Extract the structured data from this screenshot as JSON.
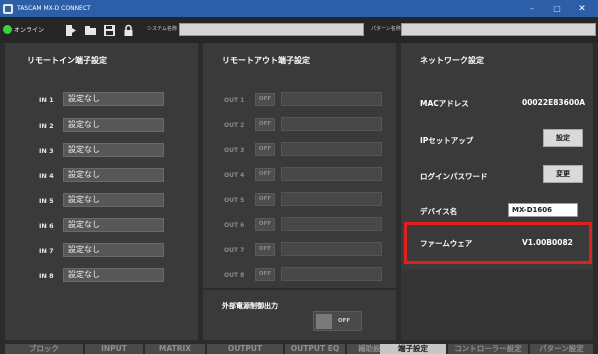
{
  "window": {
    "title": "TASCAM MX-D CONNECT",
    "minimize": "–",
    "maximize": "□",
    "close": "✕"
  },
  "toolbar": {
    "status": "オンライン",
    "system_name_label": "システム名称",
    "system_name_value": "",
    "pattern_name_label": "パターン名称",
    "pattern_name_value": "",
    "icons": [
      "export-icon",
      "folder-open-icon",
      "save-icon",
      "lock-icon"
    ]
  },
  "remote_in": {
    "title": "リモートイン端子設定",
    "rows": [
      {
        "label": "IN 1",
        "value": "設定なし"
      },
      {
        "label": "IN 2",
        "value": "設定なし"
      },
      {
        "label": "IN 3",
        "value": "設定なし"
      },
      {
        "label": "IN 4",
        "value": "設定なし"
      },
      {
        "label": "IN 5",
        "value": "設定なし"
      },
      {
        "label": "IN 6",
        "value": "設定なし"
      },
      {
        "label": "IN 7",
        "value": "設定なし"
      },
      {
        "label": "IN 8",
        "value": "設定なし"
      }
    ]
  },
  "remote_out": {
    "title": "リモートアウト端子設定",
    "rows": [
      {
        "label": "OUT 1",
        "button": "OFF"
      },
      {
        "label": "OUT 2",
        "button": "OFF"
      },
      {
        "label": "OUT 3",
        "button": "OFF"
      },
      {
        "label": "OUT 4",
        "button": "OFF"
      },
      {
        "label": "OUT 5",
        "button": "OFF"
      },
      {
        "label": "OUT 6",
        "button": "OFF"
      },
      {
        "label": "OUT 7",
        "button": "OFF"
      },
      {
        "label": "OUT 8",
        "button": "OFF"
      }
    ],
    "external_power": {
      "title": "外部電源制御出力",
      "state": "OFF"
    }
  },
  "network": {
    "title": "ネットワーク設定",
    "mac_label": "MACアドレス",
    "mac_value": "00022E83600A",
    "ip_label": "IPセットアップ",
    "ip_button": "設定",
    "password_label": "ログインパスワード",
    "password_button": "変更",
    "device_name_label": "デバイス名",
    "device_name_value": "MX-D1606",
    "firmware_label": "ファームウェア",
    "firmware_value": "V1.00B0082"
  },
  "tabs": [
    "ブロック",
    "INPUT",
    "MATRIX",
    "OUTPUT",
    "OUTPUT EQ",
    "補助設定",
    "端子設定",
    "コントローラー設定",
    "パターン設定"
  ],
  "active_tab": "端子設定",
  "colors": {
    "titlebar": "#2c5fa8",
    "status_online": "#3ad13a",
    "highlight": "#e02020"
  }
}
